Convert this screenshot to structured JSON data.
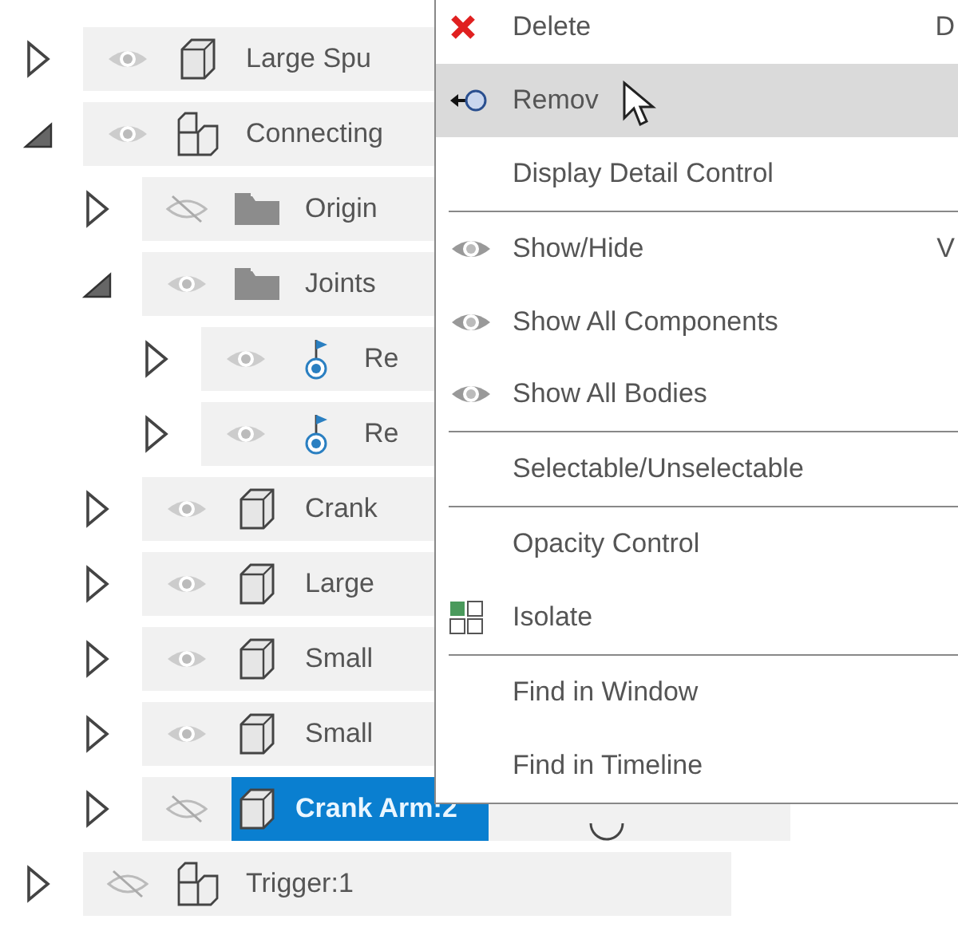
{
  "tree": [
    {
      "label": "Large Spu",
      "kind": "component",
      "expanded": false,
      "visible": true,
      "selected": false
    },
    {
      "label": "Connecting",
      "kind": "assembly",
      "expanded": true,
      "visible": true,
      "selected": false,
      "children": [
        {
          "label": "Origin",
          "kind": "folder",
          "expanded": false,
          "visible": false,
          "selected": false
        },
        {
          "label": "Joints",
          "kind": "folder",
          "expanded": true,
          "visible": true,
          "selected": false,
          "children": [
            {
              "label": "Re",
              "kind": "joint",
              "expanded": false,
              "visible": true,
              "selected": false
            },
            {
              "label": "Re",
              "kind": "joint",
              "expanded": false,
              "visible": true,
              "selected": false
            }
          ]
        },
        {
          "label": "Crank",
          "kind": "component",
          "expanded": false,
          "visible": true,
          "selected": false
        },
        {
          "label": "Large",
          "kind": "component",
          "expanded": false,
          "visible": true,
          "selected": false
        },
        {
          "label": "Small",
          "kind": "component",
          "expanded": false,
          "visible": true,
          "selected": false
        },
        {
          "label": "Small",
          "kind": "component",
          "expanded": false,
          "visible": true,
          "selected": false
        },
        {
          "label": "Crank Arm:2",
          "kind": "component",
          "expanded": false,
          "visible": false,
          "selected": true
        }
      ]
    },
    {
      "label": "Trigger:1",
      "kind": "assembly",
      "expanded": false,
      "visible": false,
      "selected": false
    }
  ],
  "context_menu": {
    "items": [
      {
        "kind": "delete",
        "label": "Delete",
        "shortcut": "D",
        "hovered": false
      },
      {
        "kind": "remove",
        "label": "Remov",
        "hovered": true
      },
      {
        "kind": "item",
        "label": "Display Detail Control",
        "hovered": false
      },
      {
        "kind": "separator"
      },
      {
        "kind": "toggle",
        "label": "Show/Hide",
        "shortcut": "V",
        "hovered": false
      },
      {
        "kind": "toggle",
        "label": "Show All Components",
        "hovered": false
      },
      {
        "kind": "toggle",
        "label": "Show All Bodies",
        "hovered": false
      },
      {
        "kind": "separator"
      },
      {
        "kind": "item",
        "label": "Selectable/Unselectable",
        "hovered": false
      },
      {
        "kind": "separator"
      },
      {
        "kind": "item",
        "label": "Opacity Control",
        "hovered": false
      },
      {
        "kind": "isolate",
        "label": "Isolate",
        "hovered": false
      },
      {
        "kind": "separator"
      },
      {
        "kind": "item",
        "label": "Find in Window",
        "hovered": false
      },
      {
        "kind": "item",
        "label": "Find in Timeline",
        "hovered": false
      }
    ]
  }
}
